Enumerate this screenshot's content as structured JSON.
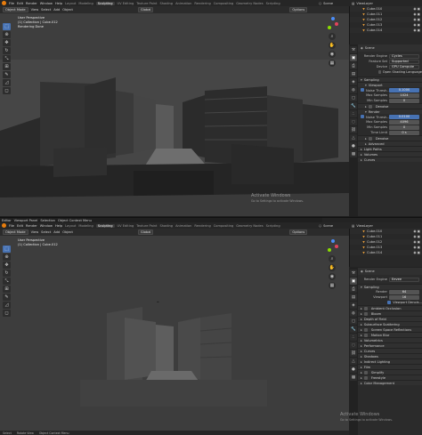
{
  "top": {
    "menu": [
      "File",
      "Edit",
      "Render",
      "Window",
      "Help"
    ],
    "workspaces": [
      "Layout",
      "Modeling",
      "Sculpting",
      "UV Editing",
      "Texture Paint",
      "Shading",
      "Animation",
      "Rendering",
      "Compositing",
      "Geometry Nodes",
      "Scripting"
    ],
    "active_workspace": "Sculpting",
    "scene_label": "Scene",
    "view_layer_label": "ViewLayer",
    "vp_header": {
      "mode": "Object Mode",
      "view": "View",
      "select": "Select",
      "add": "Add",
      "object": "Object",
      "orientation": "Global",
      "options": "Options"
    },
    "vp_info": [
      "User Perspective",
      "(1) Collection | Cube.012",
      "Rendering Done"
    ],
    "outliner": [
      "Cube.010",
      "Cube.011",
      "Cube.012",
      "Cube.013",
      "Cube.014"
    ],
    "props_title": "Scene",
    "render_engine_label": "Render Engine",
    "render_engine": "Cycles",
    "feature_set_label": "Feature Set",
    "feature_set": "Supported",
    "device_label": "Device",
    "device": "GPU Compute",
    "open_shading_language": "Open Shading Language",
    "sampling": "Sampling",
    "viewport": "Viewport",
    "noise_threshold_label": "Noise Thresh...",
    "noise_threshold_vp": "0.1000",
    "max_samples_label": "Max Samples",
    "max_samples_vp": "1024",
    "min_samples_label": "Min Samples",
    "min_samples_vp": "0",
    "denoise": "Denoise",
    "render": "Render",
    "noise_threshold_r": "0.0100",
    "max_samples_r": "4096",
    "min_samples_r": "0",
    "time_limit_label": "Time Limit",
    "time_limit": "0 s",
    "denoise_r": "Denoise",
    "advanced": "Advanced",
    "light_paths": "Light Paths",
    "volumes": "Volumes",
    "curves": "Curves"
  },
  "bottom": {
    "editor_menu": [
      "Editor",
      "Viewport Panel",
      "Selection",
      "Object Context Menu"
    ],
    "menu": [
      "File",
      "Edit",
      "Render",
      "Window",
      "Help"
    ],
    "workspaces": [
      "Layout",
      "Modeling",
      "Sculpting",
      "UV Editing",
      "Texture Paint",
      "Shading",
      "Animation",
      "Rendering",
      "Compositing",
      "Geometry Nodes",
      "Scripting"
    ],
    "active_workspace": "Sculpting",
    "scene_label": "Scene",
    "view_layer_label": "ViewLayer",
    "vp_header": {
      "mode": "Object Mode",
      "view": "View",
      "select": "Select",
      "add": "Add",
      "object": "Object",
      "orientation": "Global",
      "options": "Options"
    },
    "vp_info": [
      "User Perspective",
      "(1) Collection | Cube.012"
    ],
    "outliner": [
      "Cube.010",
      "Cube.011",
      "Cube.012",
      "Cube.013",
      "Cube.014"
    ],
    "props_title": "Scene",
    "render_engine_label": "Render Engine",
    "render_engine": "Eevee",
    "sampling": "Sampling",
    "render_label": "Render",
    "render_samples": "64",
    "viewport_label": "Viewport",
    "viewport_samples": "16",
    "viewport_denoising": "Viewport Denois...",
    "sections": [
      "Ambient Occlusion",
      "Bloom",
      "Depth of Field",
      "Subsurface Scattering",
      "Screen Space Reflections",
      "Motion Blur",
      "Volumetrics",
      "Performance",
      "Curves",
      "Shadows",
      "Indirect Lighting",
      "Film",
      "Simplify",
      "Freestyle",
      "Color Management"
    ],
    "status": [
      "Select",
      "Rotate View",
      "Object Context Menu"
    ]
  },
  "watermark": {
    "title": "Activate Windows",
    "sub": "Go to Settings to activate Windows."
  },
  "colors": {
    "accent": "#4772b3",
    "orange": "#e87d0d",
    "x_axis": "#e3445c",
    "y_axis": "#8bdc00",
    "z_axis": "#4b8df8"
  }
}
